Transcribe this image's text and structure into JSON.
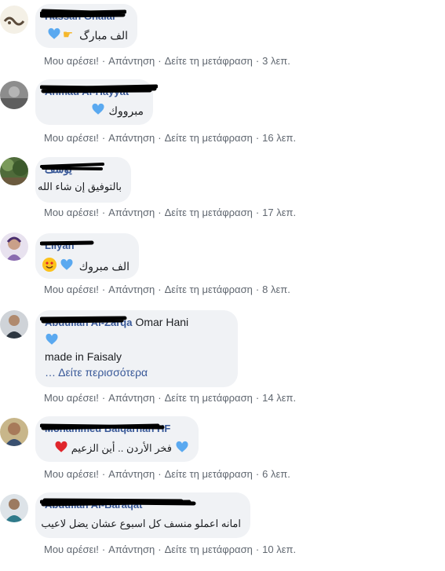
{
  "actions": {
    "like": "Μου αρέσει!",
    "reply": "Απάντηση",
    "translate": "Δείτε τη μετάφραση"
  },
  "comments": [
    {
      "author": "Hassan Ghalal",
      "text": "الف مبارگ",
      "time": "3 λεπ."
    },
    {
      "author": "Ahmad Al-Hayyat",
      "text": "مبرووك",
      "time": "16 λεπ."
    },
    {
      "author": "يوسف",
      "text": "بالتوفيق إن شاء الله",
      "time": "17 λεπ."
    },
    {
      "author": "Lilyan",
      "text": "الف مبروك",
      "time": "8 λεπ."
    },
    {
      "author": "Abdullah Al-Zarqa",
      "author_tag": "Omar Hani",
      "text": "made in Faisaly",
      "see_more": "… Δείτε περισσότερα",
      "time": "14 λεπ."
    },
    {
      "author": "Mohammed Balqarnah HF",
      "text": "فخر الأردن .. أين الزعيم",
      "time": "6 λεπ."
    },
    {
      "author": "Abdullah Al-Baraqat",
      "text": "امانه اعملو منسف كل اسبوع عشان يضل لاعيب",
      "time": "10 λεπ."
    }
  ],
  "colors": {
    "bubble": "#f0f2f5",
    "link": "#385898",
    "meta": "#606770",
    "heart_blue": "#5aa9f0",
    "heart_red": "#e0262c"
  }
}
